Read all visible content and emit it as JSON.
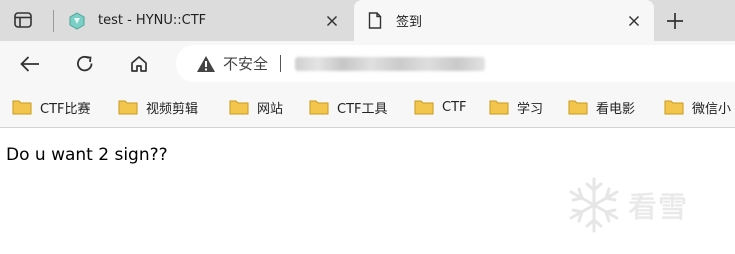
{
  "browser": {
    "tabs": [
      {
        "title": "test - HYNU::CTF",
        "favicon": "ctf-logo-icon",
        "active": false
      },
      {
        "title": "签到",
        "favicon": "document-icon",
        "active": true
      }
    ],
    "address": {
      "security_label": "不安全",
      "url": ""
    },
    "bookmarks": [
      {
        "label": "CTF比赛"
      },
      {
        "label": "视频剪辑"
      },
      {
        "label": "网站"
      },
      {
        "label": "CTF工具"
      },
      {
        "label": "CTF"
      },
      {
        "label": "学习"
      },
      {
        "label": "看电影"
      },
      {
        "label": "微信小"
      }
    ]
  },
  "page": {
    "text": "Do u want 2 sign??",
    "watermark": "看雪"
  },
  "colors": {
    "tabstrip": "#dcdcdc",
    "toolbar": "#f7f7f7",
    "folder": "#f3c54c"
  }
}
